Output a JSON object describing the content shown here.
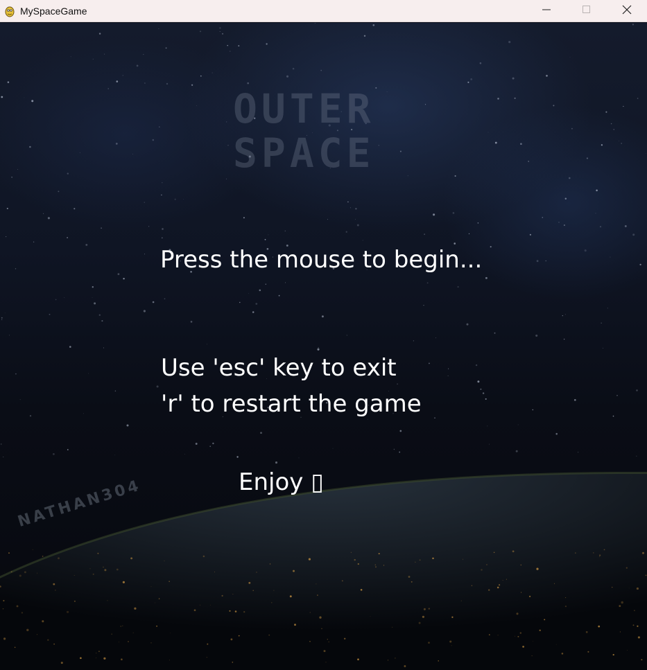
{
  "window": {
    "title": "MySpaceGame",
    "icon": "pygame-snake-icon",
    "controls": {
      "minimize_icon": "minimize-icon",
      "maximize_icon": "maximize-icon",
      "close_icon": "close-icon"
    }
  },
  "game": {
    "logo_line1": "OUTER",
    "logo_line2": "SPACE",
    "press_text": "Press the mouse to begin...",
    "esc_text": "Use 'esc' key to exit",
    "restart_text": "'r' to restart the game",
    "enjoy_text": "Enjoy ▯",
    "watermark": "NATHAN304",
    "colors": {
      "titlebar": "#f7eeee",
      "text": "#ffffff",
      "background": "#0a0e1a"
    }
  }
}
